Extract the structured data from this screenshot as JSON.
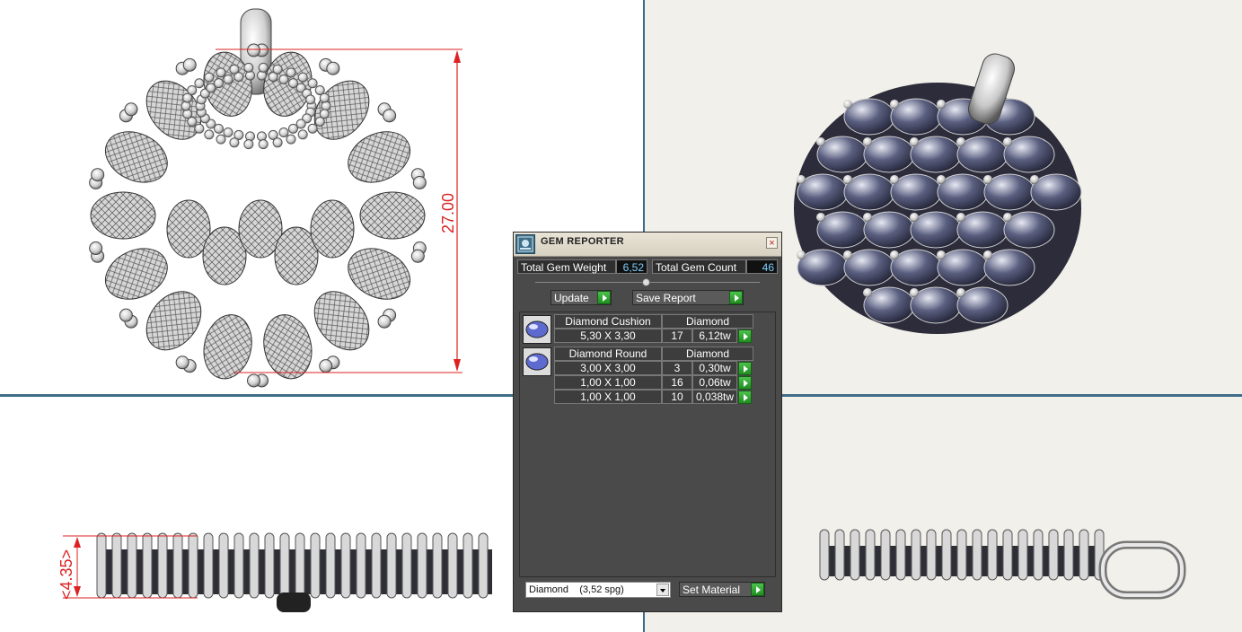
{
  "viewport_front": {
    "dimension_label": "27.00"
  },
  "viewport_side": {
    "dimension_label": "<4.35>"
  },
  "panel": {
    "title": "GEM REPORTER",
    "close_glyph": "×",
    "total_gem_weight_label": "Total Gem Weight",
    "total_gem_weight_value": "6,52",
    "total_gem_count_label": "Total Gem Count",
    "total_gem_count_value": "46",
    "update_label": "Update",
    "save_report_label": "Save Report",
    "groups": [
      {
        "shape": "Diamond Cushion",
        "material": "Diamond",
        "rows": [
          {
            "size": "5,30 X 3,30",
            "count": "17",
            "weight": "6,12tw"
          }
        ]
      },
      {
        "shape": "Diamond Round",
        "material": "Diamond",
        "rows": [
          {
            "size": "3,00 X 3,00",
            "count": "3",
            "weight": "0,30tw"
          },
          {
            "size": "1,00 X 1,00",
            "count": "16",
            "weight": "0,06tw"
          },
          {
            "size": "1,00 X 1,00",
            "count": "10",
            "weight": "0,038tw"
          }
        ]
      }
    ],
    "material_select_value": "Diamond    (3,52 spg)",
    "set_material_label": "Set Material"
  },
  "colors": {
    "viewport_divider": "#3f6d87",
    "dimension": "#dd2222",
    "panel_bg": "#4a4a4a",
    "value_text": "#7bd0ff",
    "go_button": "#2fa82f"
  }
}
